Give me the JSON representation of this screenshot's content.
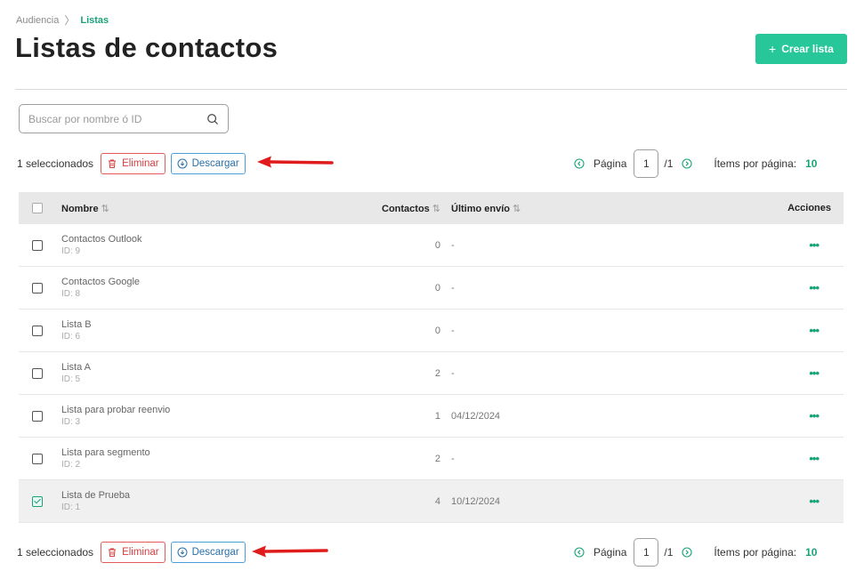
{
  "breadcrumb": {
    "parent": "Audiencia",
    "current": "Listas"
  },
  "header": {
    "title": "Listas de contactos",
    "create_label": "Crear lista"
  },
  "search": {
    "placeholder": "Buscar por nombre ó ID"
  },
  "selection": {
    "count_label": "1 seleccionados",
    "delete_label": "Eliminar",
    "download_label": "Descargar"
  },
  "pagination": {
    "page_label": "Página",
    "current_page": "1",
    "total_label": "/1",
    "items_label": "Ítems por página:",
    "items_value": "10"
  },
  "table": {
    "headers": {
      "name": "Nombre",
      "contacts": "Contactos",
      "last_send": "Último envío",
      "actions": "Acciones"
    },
    "sort_glyph": "⇅",
    "action_glyph": "•••",
    "rows": [
      {
        "name": "Contactos Outlook",
        "id": "ID: 9",
        "contacts": "0",
        "last_send": "-",
        "selected": false
      },
      {
        "name": "Contactos Google",
        "id": "ID: 8",
        "contacts": "0",
        "last_send": "-",
        "selected": false
      },
      {
        "name": "Lista B",
        "id": "ID: 6",
        "contacts": "0",
        "last_send": "-",
        "selected": false
      },
      {
        "name": "Lista A",
        "id": "ID: 5",
        "contacts": "2",
        "last_send": "-",
        "selected": false
      },
      {
        "name": "Lista para probar reenvio",
        "id": "ID: 3",
        "contacts": "1",
        "last_send": "04/12/2024",
        "selected": false
      },
      {
        "name": "Lista para segmento",
        "id": "ID: 2",
        "contacts": "2",
        "last_send": "-",
        "selected": false
      },
      {
        "name": "Lista de Prueba",
        "id": "ID: 1",
        "contacts": "4",
        "last_send": "10/12/2024",
        "selected": true
      }
    ]
  },
  "colors": {
    "accent": "#27c79a",
    "accent_text": "#1aa37a",
    "danger": "#d43f3f",
    "info": "#2a6fa8",
    "arrow": "#e01b1b"
  },
  "icons": {
    "search": "search-icon",
    "delete": "trash-icon",
    "download": "download-icon",
    "prev": "chevron-left-circle-icon",
    "next": "chevron-right-circle-icon",
    "annotation": "red-arrow-icon"
  }
}
